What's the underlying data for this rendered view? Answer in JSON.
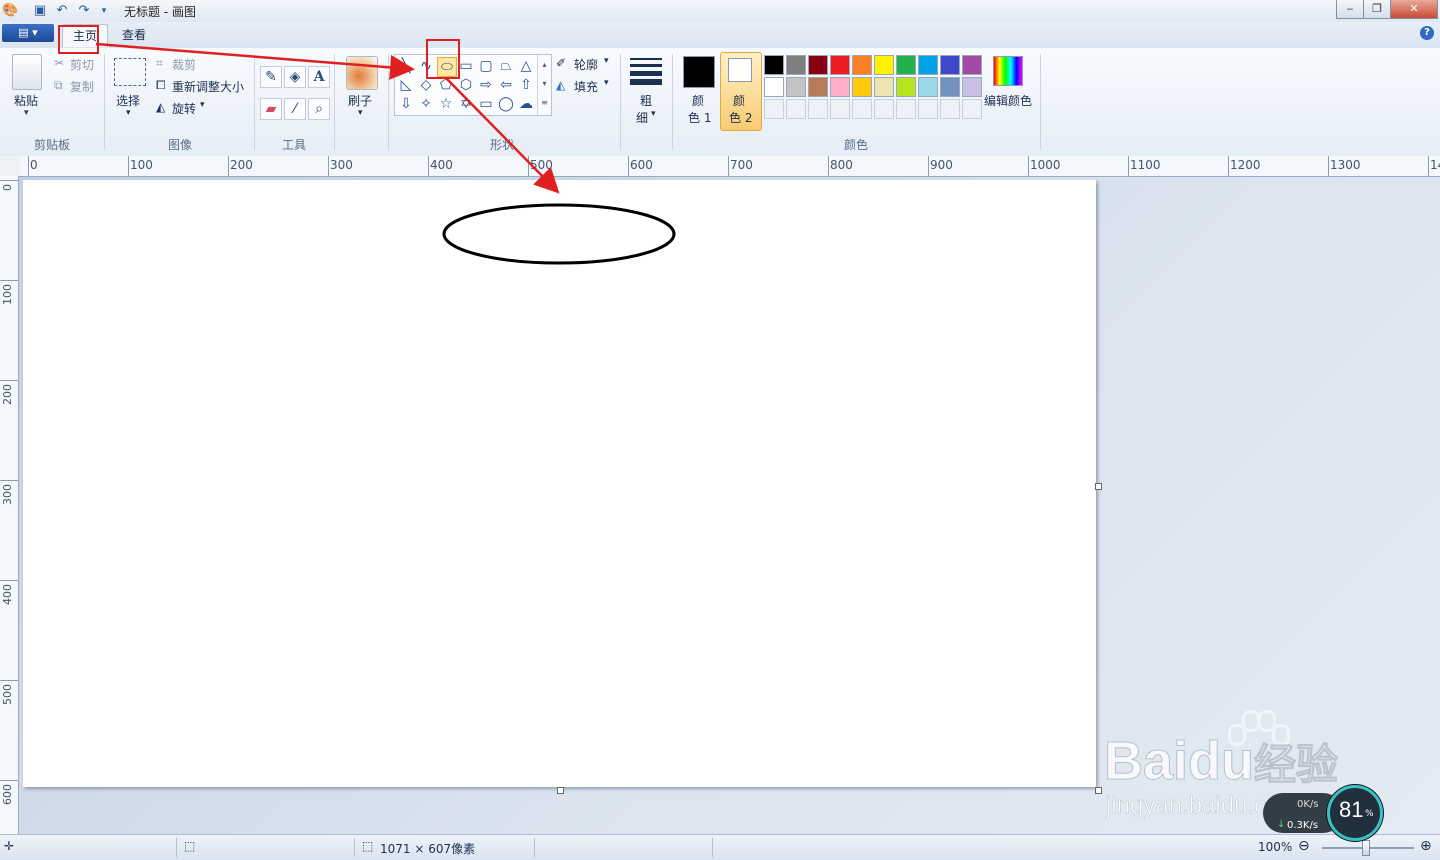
{
  "window": {
    "title": "无标题 - 画图"
  },
  "tabs": {
    "home": "主页",
    "view": "查看"
  },
  "clipboard": {
    "paste": "粘贴",
    "cut": "剪切",
    "copy": "复制",
    "group": "剪贴板"
  },
  "image": {
    "select": "选择",
    "crop": "裁剪",
    "resize": "重新调整大小",
    "rotate": "旋转",
    "group": "图像"
  },
  "tools": {
    "group": "工具"
  },
  "brushes": {
    "label": "刷子"
  },
  "shapes": {
    "outline": "轮廓",
    "fill": "填充",
    "group": "形状"
  },
  "size": {
    "label_a": "粗",
    "label_b": "细"
  },
  "colors": {
    "color1_a": "颜",
    "color1_b": "色 1",
    "color2_a": "颜",
    "color2_b": "色 2",
    "edit": "编辑颜色",
    "group": "颜色",
    "palette_row1": [
      "#000000",
      "#7f7f7f",
      "#880015",
      "#ed1c24",
      "#ff7f27",
      "#fff200",
      "#22b14c",
      "#00a2e8",
      "#3f48cc",
      "#a349a4"
    ],
    "palette_row2": [
      "#ffffff",
      "#c3c3c3",
      "#b97a57",
      "#ffaec9",
      "#ffc90e",
      "#efe4b0",
      "#b5e61d",
      "#99d9ea",
      "#7092be",
      "#c8bfe7"
    ]
  },
  "ruler": {
    "h": [
      "0",
      "100",
      "200",
      "300",
      "400",
      "500",
      "600",
      "700",
      "800",
      "900",
      "1000",
      "1100",
      "1200",
      "1300",
      "14"
    ],
    "v": [
      "0",
      "100",
      "200",
      "300",
      "400",
      "500",
      "600"
    ]
  },
  "status": {
    "dimensions": "1071 × 607像素",
    "zoom": "100%"
  },
  "watermark": {
    "brand_a": "Bai",
    "brand_b": "du",
    "brand_c": "经验",
    "url": "jingyan.baidu.com"
  },
  "net": {
    "up": "0K/s",
    "down": "0.3K/s",
    "percent": "81",
    "pct_sign": "%"
  }
}
